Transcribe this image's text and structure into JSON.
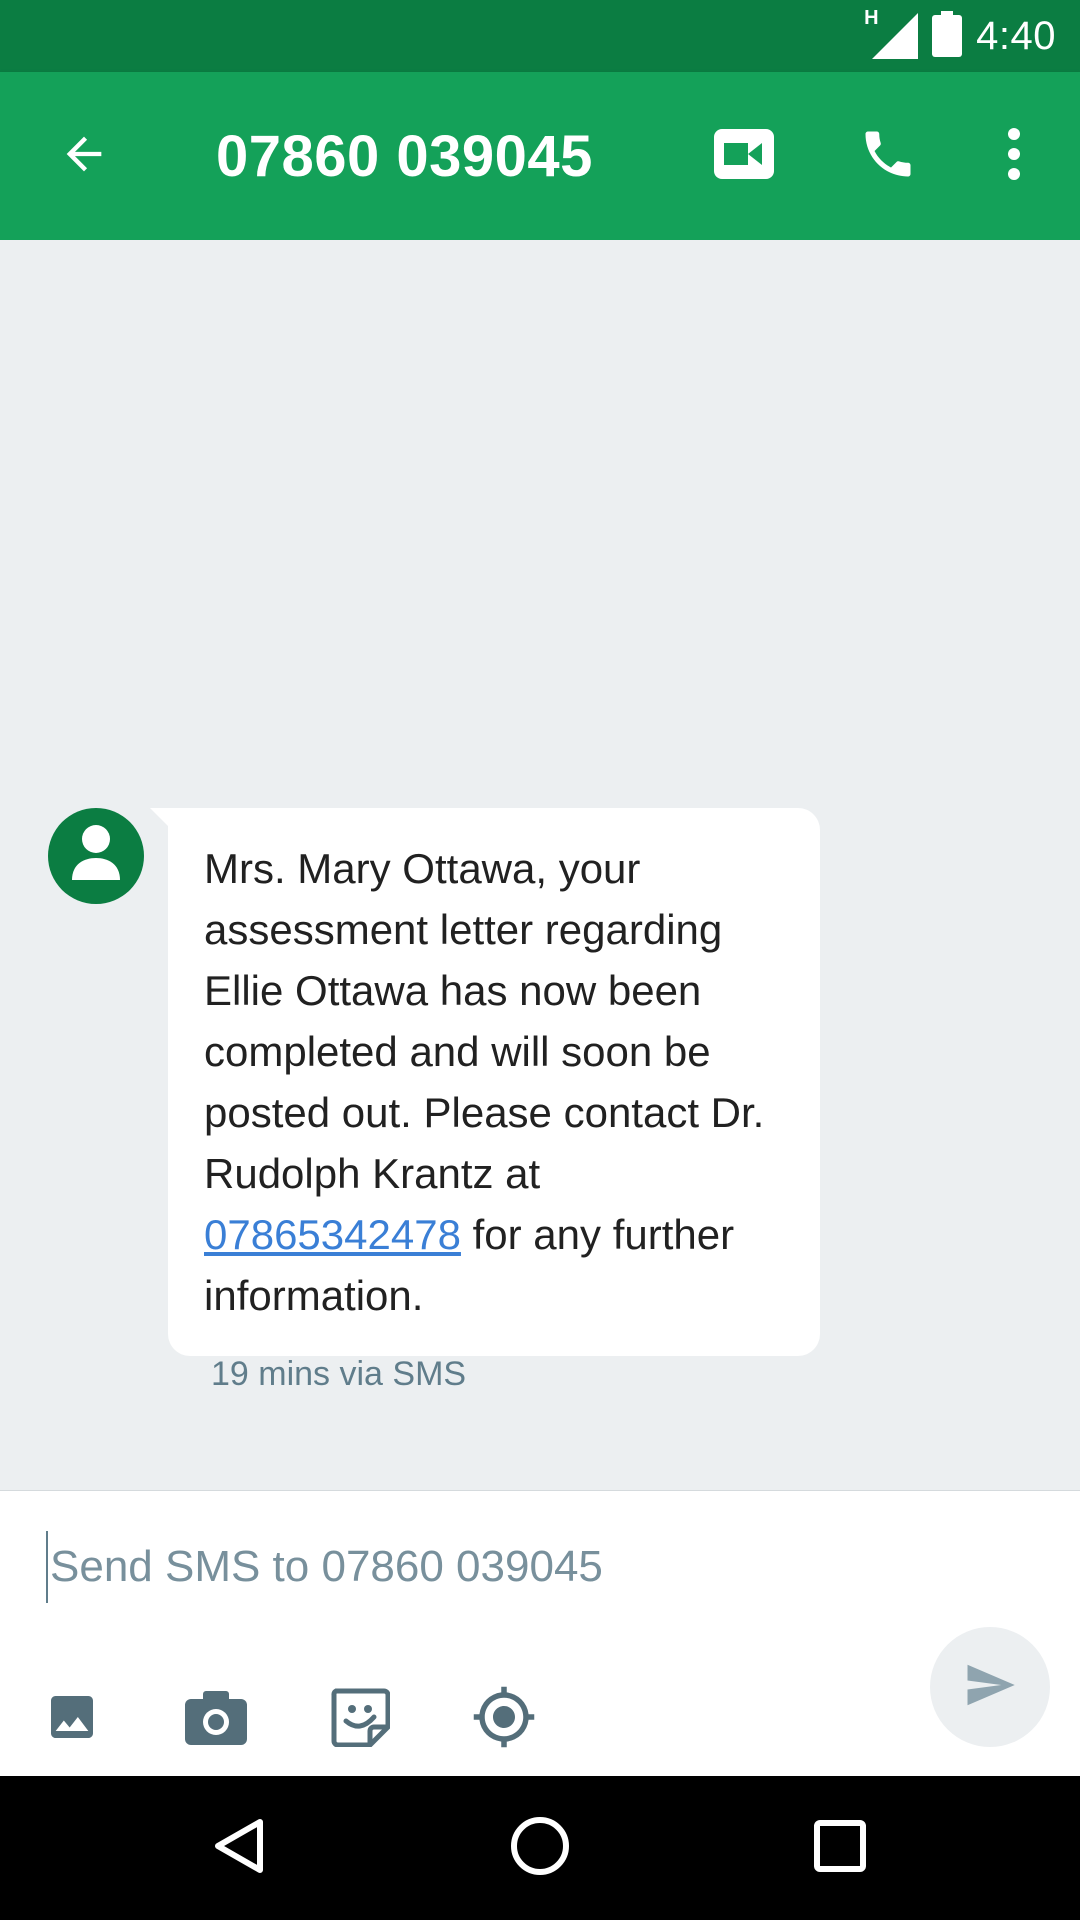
{
  "status_bar": {
    "time": "4:40",
    "network_label": "H",
    "icons": [
      "signal-icon",
      "battery-icon"
    ]
  },
  "app_bar": {
    "title": "07860 039045",
    "icons": [
      "back-arrow-icon",
      "video-call-icon",
      "phone-icon",
      "more-vert-icon"
    ],
    "color": "#14a159"
  },
  "message": {
    "text_before_link": "Mrs. Mary Ottawa, your assessment letter regarding Ellie Ottawa has now been completed and will soon be posted out. Please contact Dr. Rudolph Krantz at ",
    "link": "07865342478",
    "text_after_link": " for any further information.",
    "meta": "19 mins via SMS",
    "avatar_icon": "person-icon"
  },
  "composer": {
    "placeholder": "Send SMS to 07860 039045",
    "tools": [
      "gallery-icon",
      "camera-icon",
      "sticker-icon",
      "location-icon"
    ],
    "send_icon": "send-icon"
  },
  "nav_bar": {
    "icons": [
      "back-triangle-icon",
      "home-circle-icon",
      "recents-square-icon"
    ]
  },
  "colors": {
    "status_bar": "#0b7d42",
    "accent": "#14a159",
    "background": "#eceff1",
    "link": "#3a7fd6"
  }
}
